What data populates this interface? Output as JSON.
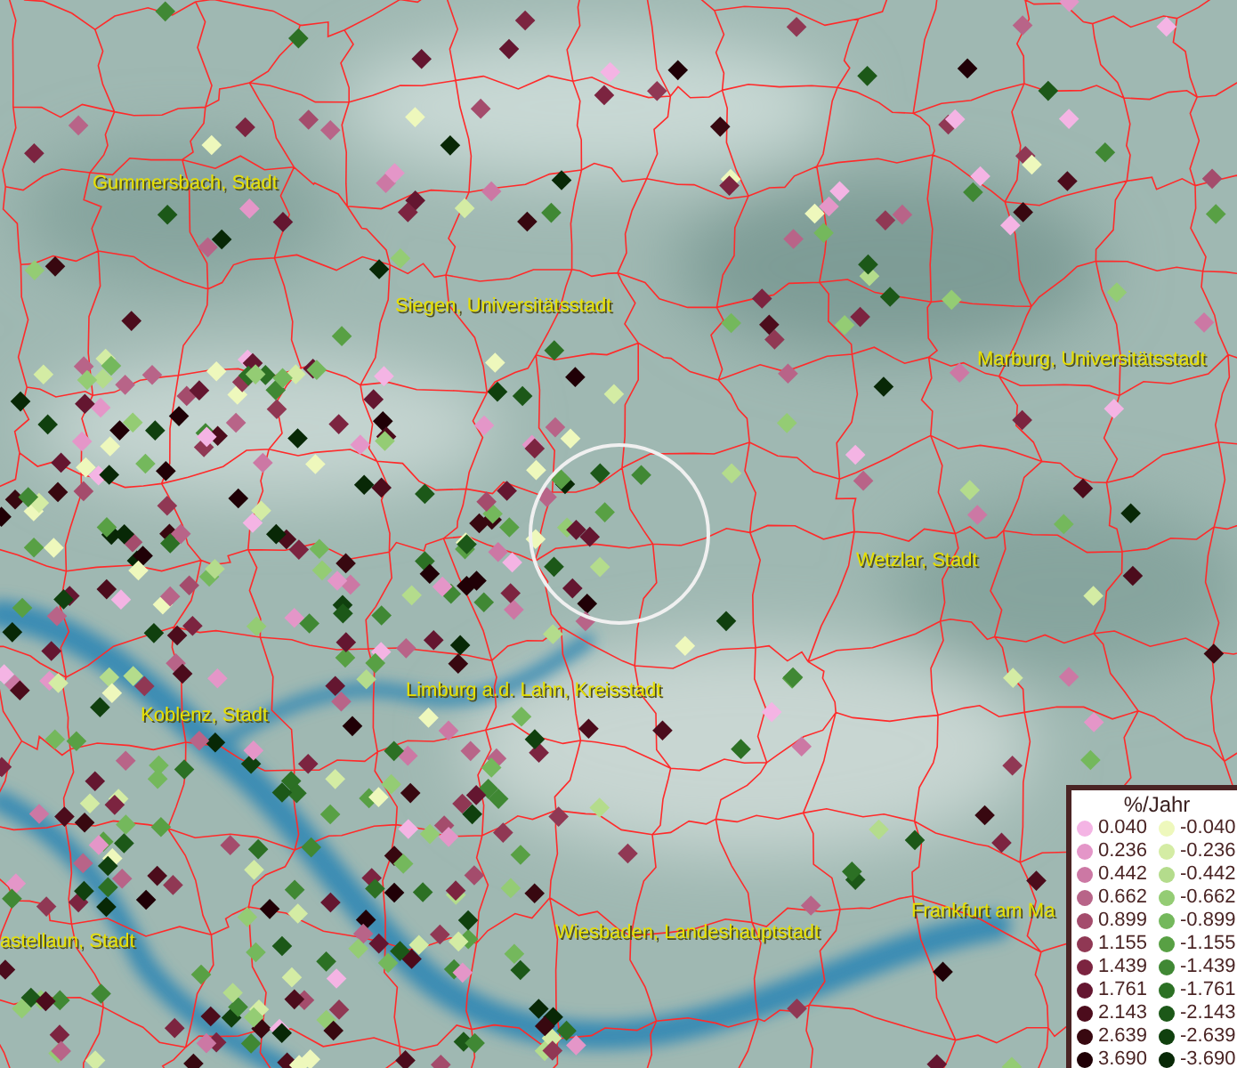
{
  "map": {
    "places": [
      {
        "name": "Gummersbach, Stadt"
      },
      {
        "name": "Siegen, Universitätsstadt"
      },
      {
        "name": "Marburg, Universitätsstadt"
      },
      {
        "name": "Wetzlar, Stadt"
      },
      {
        "name": "Limburg a.d. Lahn, Kreisstadt"
      },
      {
        "name": "Koblenz, Stadt"
      },
      {
        "name": "Wiesbaden, Landeshauptstadt"
      },
      {
        "name": "Frankfurt am Ma"
      },
      {
        "name": "astellaun, Stadt"
      }
    ]
  },
  "legend": {
    "title": "%/Jahr",
    "items": [
      {
        "value": "0.040",
        "color": "#f4b4e4"
      },
      {
        "value": "-0.040",
        "color": "#eef8bc"
      },
      {
        "value": "0.236",
        "color": "#e496c8"
      },
      {
        "value": "-0.236",
        "color": "#d4eca4"
      },
      {
        "value": "0.442",
        "color": "#cc78a4"
      },
      {
        "value": "-0.442",
        "color": "#b4dc8c"
      },
      {
        "value": "0.662",
        "color": "#b86488"
      },
      {
        "value": "-0.662",
        "color": "#94cc74"
      },
      {
        "value": "0.899",
        "color": "#a44c6c"
      },
      {
        "value": "-0.899",
        "color": "#74b85c"
      },
      {
        "value": "1.155",
        "color": "#903854"
      },
      {
        "value": "-1.155",
        "color": "#58a044"
      },
      {
        "value": "1.439",
        "color": "#7c2440"
      },
      {
        "value": "-1.439",
        "color": "#408834"
      },
      {
        "value": "1.761",
        "color": "#641630"
      },
      {
        "value": "-1.761",
        "color": "#2c7024"
      },
      {
        "value": "2.143",
        "color": "#4c0c1c"
      },
      {
        "value": "-2.143",
        "color": "#1c5818"
      },
      {
        "value": "2.639",
        "color": "#380810"
      },
      {
        "value": "-2.639",
        "color": "#10400e"
      },
      {
        "value": "3.690",
        "color": "#200006"
      },
      {
        "value": "-3.690",
        "color": "#082806"
      }
    ]
  }
}
